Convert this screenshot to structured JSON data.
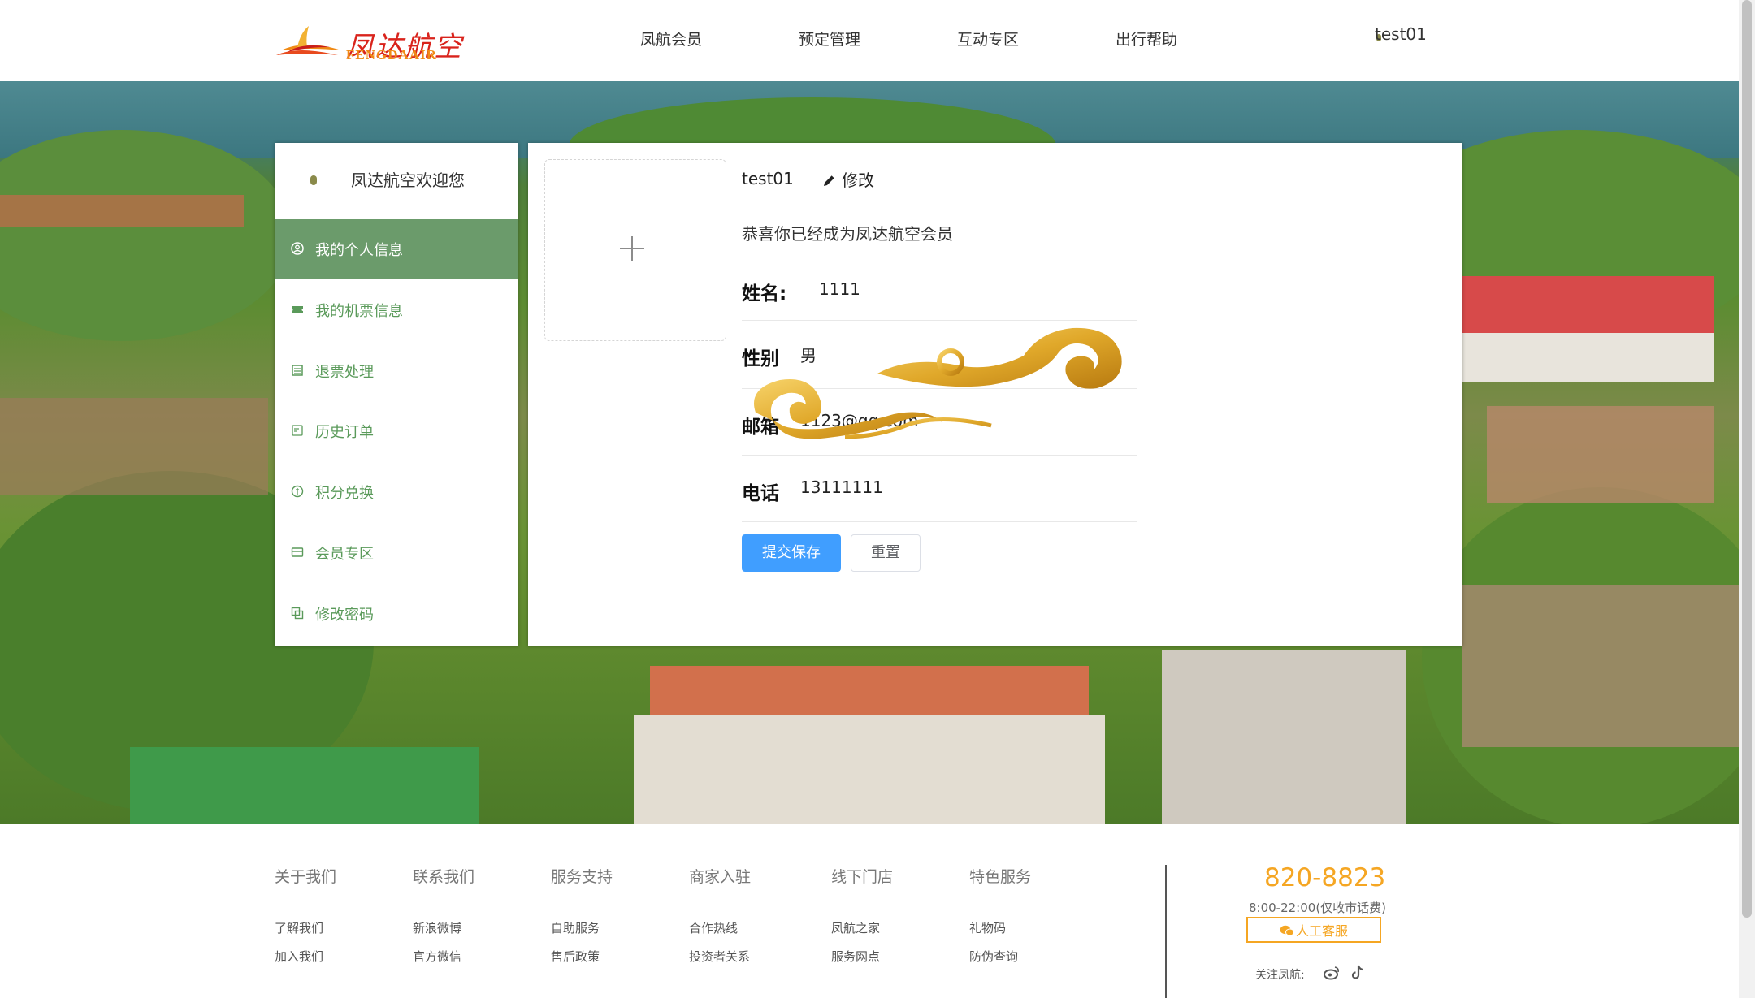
{
  "header": {
    "logo_text": "凤达航空",
    "logo_sub": "FENGDAAIR",
    "nav": [
      "凤航会员",
      "预定管理",
      "互动专区",
      "出行帮助"
    ],
    "username": "test01"
  },
  "sidebar": {
    "welcome": "凤达航空欢迎您",
    "items": [
      {
        "label": "我的个人信息",
        "icon": "user-circle-icon",
        "active": true
      },
      {
        "label": "我的机票信息",
        "icon": "ticket-icon",
        "active": false
      },
      {
        "label": "退票处理",
        "icon": "document-icon",
        "active": false
      },
      {
        "label": "历史订单",
        "icon": "order-icon",
        "active": false
      },
      {
        "label": "积分兑换",
        "icon": "coin-icon",
        "active": false
      },
      {
        "label": "会员专区",
        "icon": "card-icon",
        "active": false
      },
      {
        "label": "修改密码",
        "icon": "copy-icon",
        "active": false
      }
    ],
    "active_color": "#6b9b6b"
  },
  "profile": {
    "username": "test01",
    "edit_label": "修改",
    "congrats": "恭喜你已经成为凤达航空会员",
    "fields": [
      {
        "key": "姓名:",
        "value": "1111"
      },
      {
        "key": "性别",
        "value": "男"
      },
      {
        "key": "邮箱",
        "value": "1123@qq.com"
      },
      {
        "key": "电话",
        "value": "13111111"
      }
    ],
    "submit_label": "提交保存",
    "reset_label": "重置",
    "primary_color": "#409eff"
  },
  "footer": {
    "columns": [
      {
        "title": "关于我们",
        "items": [
          "了解我们",
          "加入我们"
        ]
      },
      {
        "title": "联系我们",
        "items": [
          "新浪微博",
          "官方微信"
        ]
      },
      {
        "title": "服务支持",
        "items": [
          "自助服务",
          "售后政策"
        ]
      },
      {
        "title": "商家入驻",
        "items": [
          "合作热线",
          "投资者关系"
        ]
      },
      {
        "title": "线下门店",
        "items": [
          "凤航之家",
          "服务网点"
        ]
      },
      {
        "title": "特色服务",
        "items": [
          "礼物码",
          "防伪查询"
        ]
      }
    ],
    "phone": "820-8823",
    "hours": "8:00-22:00(仅收市话费)",
    "service_label": "人工客服",
    "follow_label": "关注凤航:",
    "accent_color": "#f5a623"
  }
}
